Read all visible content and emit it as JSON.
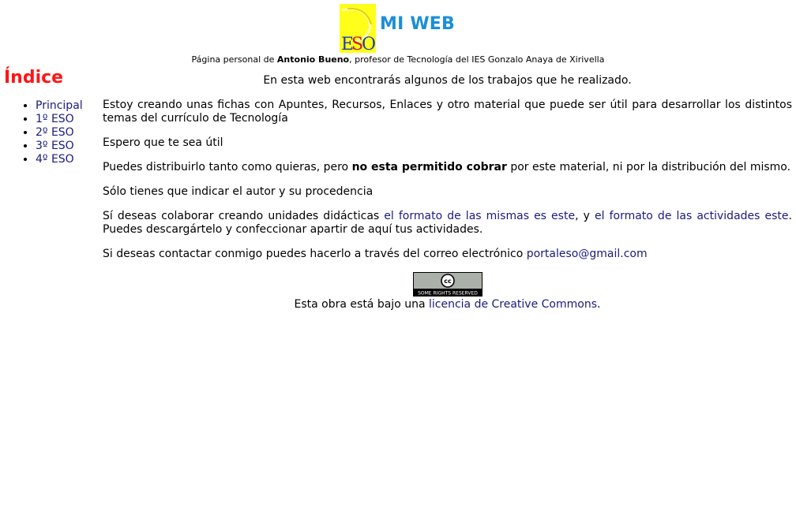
{
  "header": {
    "logo_text": "ESO",
    "title": "MI WEB",
    "subtitle_prefix": "Página personal de ",
    "author": "Antonio Bueno",
    "subtitle_suffix": ", profesor de Tecnología del IES Gonzalo Anaya de Xirivella"
  },
  "sidebar": {
    "title": "Índice",
    "items": [
      {
        "label": "Principal"
      },
      {
        "label": "1º ESO"
      },
      {
        "label": "2º ESO"
      },
      {
        "label": "3º ESO"
      },
      {
        "label": "4º ESO"
      }
    ]
  },
  "main": {
    "intro": "En esta web encontrarás algunos de los trabajos que he realizado.",
    "p1": "Estoy creando unas fichas con Apuntes, Recursos, Enlaces y otro material que puede ser útil para desarrollar los distintos temas del currículo de Tecnología",
    "p2": "Espero que te sea útil",
    "p3_a": "Puedes distribuirlo tanto como quieras, pero ",
    "p3_bold": "no esta permitido cobrar",
    "p3_b": " por este material, ni por la distribución del mismo.",
    "p4": "Sólo tienes que indicar el autor y su procedencia",
    "p5_a": "Sí deseas colaborar creando unidades didácticas ",
    "p5_link1": "el formato de las mismas es este",
    "p5_b": ", y ",
    "p5_link2": "el formato de las actividades este",
    "p5_c": ". Puedes descargártelo y confeccionar apartir de aquí tus actividades.",
    "p6_a": "Si deseas contactar conmigo puedes hacerlo a través del correo electrónico ",
    "p6_email": "portaleso@gmail.com",
    "cc_badge_text": "SOME RIGHTS RESERVED",
    "cc_badge_symbol": "cc",
    "cc_a": "Esta obra está bajo una ",
    "cc_link": "licencia de Creative Commons",
    "cc_b": "."
  },
  "colors": {
    "title_blue": "#1b8fd6",
    "index_red": "#ff1414",
    "link": "#1a1a80",
    "logo_yellow": "#ffff00"
  }
}
